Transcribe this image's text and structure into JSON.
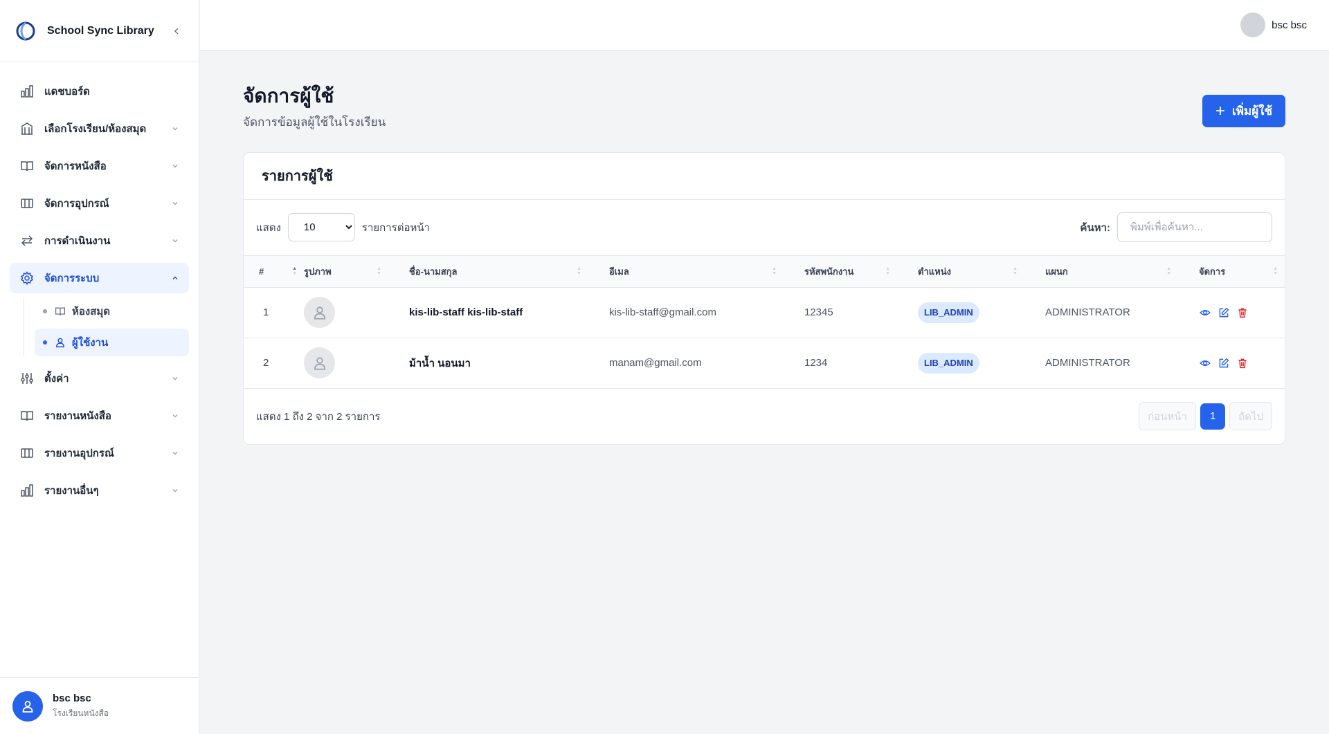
{
  "app": {
    "brand": "School Sync Library"
  },
  "header": {
    "user_name": "bsc bsc"
  },
  "sidebar": {
    "items": [
      {
        "label": "แดชบอร์ด",
        "icon": "bar-chart-icon"
      },
      {
        "label": "เลือกโรงเรียน/ห้องสมุด",
        "icon": "library-building-icon"
      },
      {
        "label": "จัดการหนังสือ",
        "icon": "book-open-icon"
      },
      {
        "label": "จัดการอุปกรณ์",
        "icon": "columns-icon"
      },
      {
        "label": "การดำเนินงาน",
        "icon": "arrows-swap-icon"
      },
      {
        "label": "จัดการระบบ",
        "icon": "gear-icon"
      },
      {
        "label": "ตั้งค่า",
        "icon": "sliders-icon"
      },
      {
        "label": "รายงานหนังสือ",
        "icon": "book-open-icon"
      },
      {
        "label": "รายงานอุปกรณ์",
        "icon": "columns-icon"
      },
      {
        "label": "รายงานอื่นๆ",
        "icon": "bar-chart-icon"
      }
    ],
    "sub_items": [
      {
        "label": "ห้องสมุด",
        "icon": "book-icon"
      },
      {
        "label": "ผู้ใช้งาน",
        "icon": "user-icon"
      }
    ],
    "footer_user": {
      "name": "bsc bsc",
      "school": "โรงเรียนหนังสือ"
    }
  },
  "page": {
    "title": "จัดการผู้ใช้",
    "subtitle": "จัดการข้อมูลผู้ใช้ในโรงเรียน",
    "add_button": "เพิ่มผู้ใช้"
  },
  "card": {
    "title": "รายการผู้ใช้",
    "show_label": "แสดง",
    "page_size": "10",
    "per_page_label": "รายการต่อหน้า",
    "search_label": "ค้นหา:",
    "search_placeholder": "พิมพ์เพื่อค้นหา..."
  },
  "table": {
    "columns": [
      "#",
      "รูปภาพ",
      "ชื่อ-นามสกุล",
      "อีเมล",
      "รหัสพนักงาน",
      "ตำแหน่ง",
      "แผนก",
      "จัดการ"
    ],
    "rows": [
      {
        "index": "1",
        "name": "kis-lib-staff kis-lib-staff",
        "email": "kis-lib-staff@gmail.com",
        "employee_id": "12345",
        "role": "LIB_ADMIN",
        "department": "ADMINISTRATOR"
      },
      {
        "index": "2",
        "name": "ม้าน้ำ นอนมา",
        "email": "manam@gmail.com",
        "employee_id": "1234",
        "role": "LIB_ADMIN",
        "department": "ADMINISTRATOR"
      }
    ]
  },
  "footer": {
    "info": "แสดง 1 ถึง 2 จาก 2 รายการ",
    "prev_label": "ก่อนหน้า",
    "current_page": "1",
    "next_label": "ถัดไป"
  },
  "colors": {
    "accent": "#2563eb",
    "badge_bg": "#dbeafe",
    "danger": "#dc2626"
  }
}
